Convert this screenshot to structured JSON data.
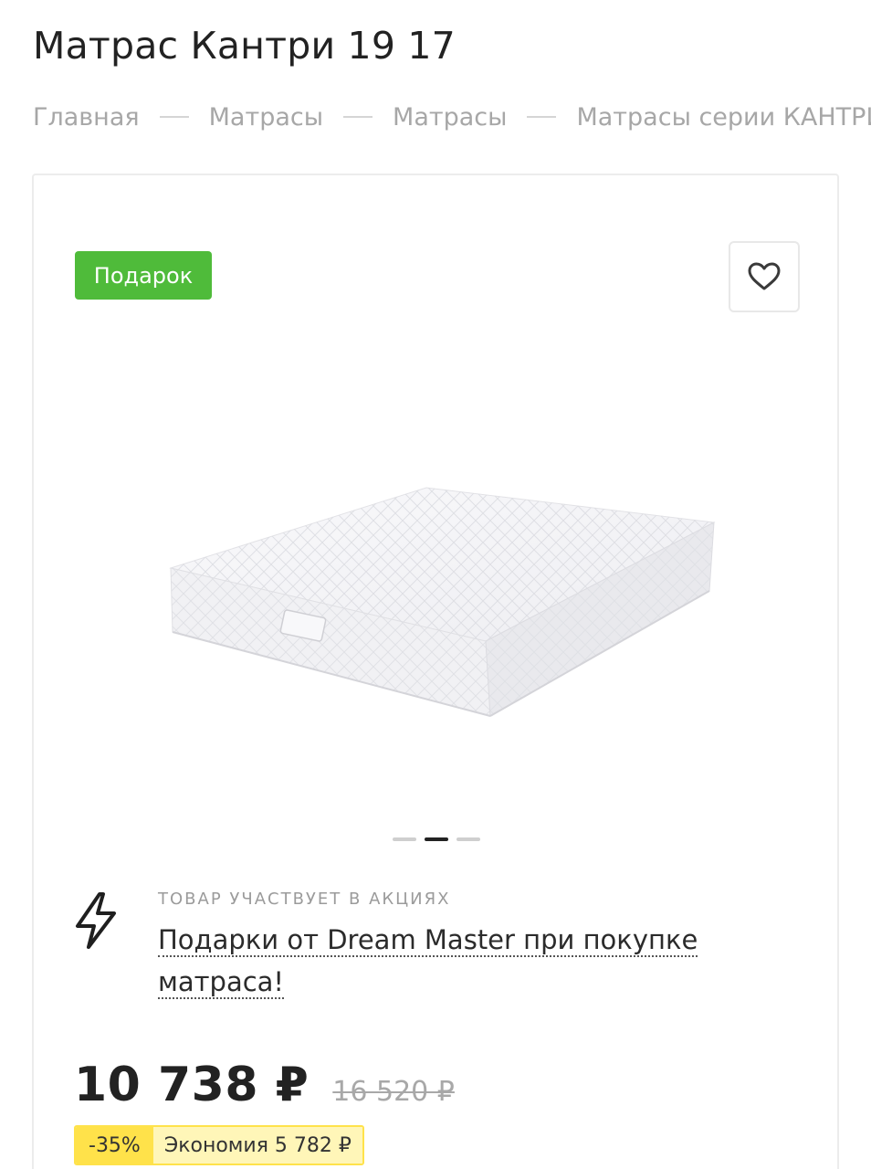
{
  "product": {
    "title": "Матрас Кантри 19 17",
    "badge": "Подарок",
    "image_alt": "mattress"
  },
  "breadcrumb": [
    {
      "label": "Главная"
    },
    {
      "label": "Матрасы"
    },
    {
      "label": "Матрасы"
    },
    {
      "label": "Матрасы серии КАНТРИ"
    }
  ],
  "gallery": {
    "slides": 3,
    "active_index": 1
  },
  "promo": {
    "caption": "ТОВАР УЧАСТВУЕТ В АКЦИЯХ",
    "link": "Подарки от Dream Master при покупке матраса!",
    "icon": "lightning-icon"
  },
  "price": {
    "current": "10 738 ₽",
    "old": "16 520 ₽",
    "discount": "-35%",
    "saving": "Экономия 5 782 ₽"
  },
  "colors": {
    "badge": "#4fbb3a",
    "discount": "#ffe24a"
  }
}
